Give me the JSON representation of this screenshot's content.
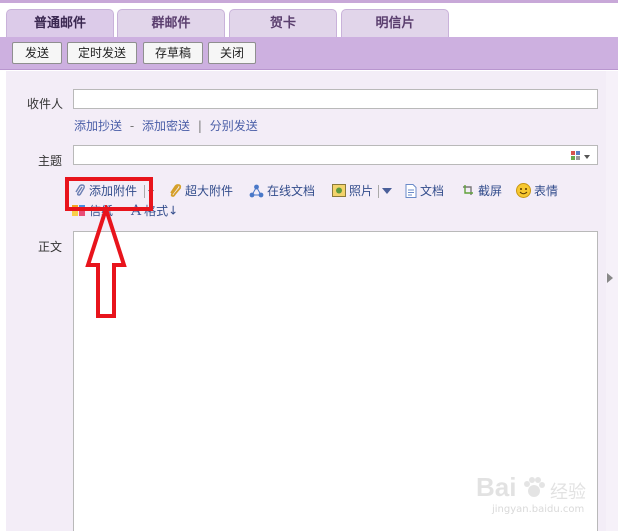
{
  "tabs": [
    {
      "label": "普通邮件",
      "active": true
    },
    {
      "label": "群邮件",
      "active": false
    },
    {
      "label": "贺卡",
      "active": false
    },
    {
      "label": "明信片",
      "active": false
    }
  ],
  "toolbar": {
    "send": "发送",
    "timed_send": "定时发送",
    "save_draft": "存草稿",
    "close": "关闭"
  },
  "form": {
    "recipient_label": "收件人",
    "recipient_value": "",
    "cc_link": "添加抄送",
    "dash": "-",
    "bcc_link": "添加密送",
    "separator": "|",
    "separate_send_link": "分别发送",
    "subject_label": "主题",
    "subject_value": "",
    "body_label": "正文"
  },
  "compose_tools": {
    "attach": "添加附件",
    "big_attach": "超大附件",
    "online_doc": "在线文档",
    "photo": "照片",
    "document": "文档",
    "screenshot": "截屏",
    "emoji": "表情",
    "stationery": "信纸",
    "format": "格式"
  },
  "colors": {
    "accent_purple": "#cdb0e0",
    "link_blue": "#334d8c",
    "highlight_red": "#e8141c"
  },
  "watermark": {
    "brand": "Bai",
    "brand2": "经验",
    "url": "jingyan.baidu.com"
  }
}
